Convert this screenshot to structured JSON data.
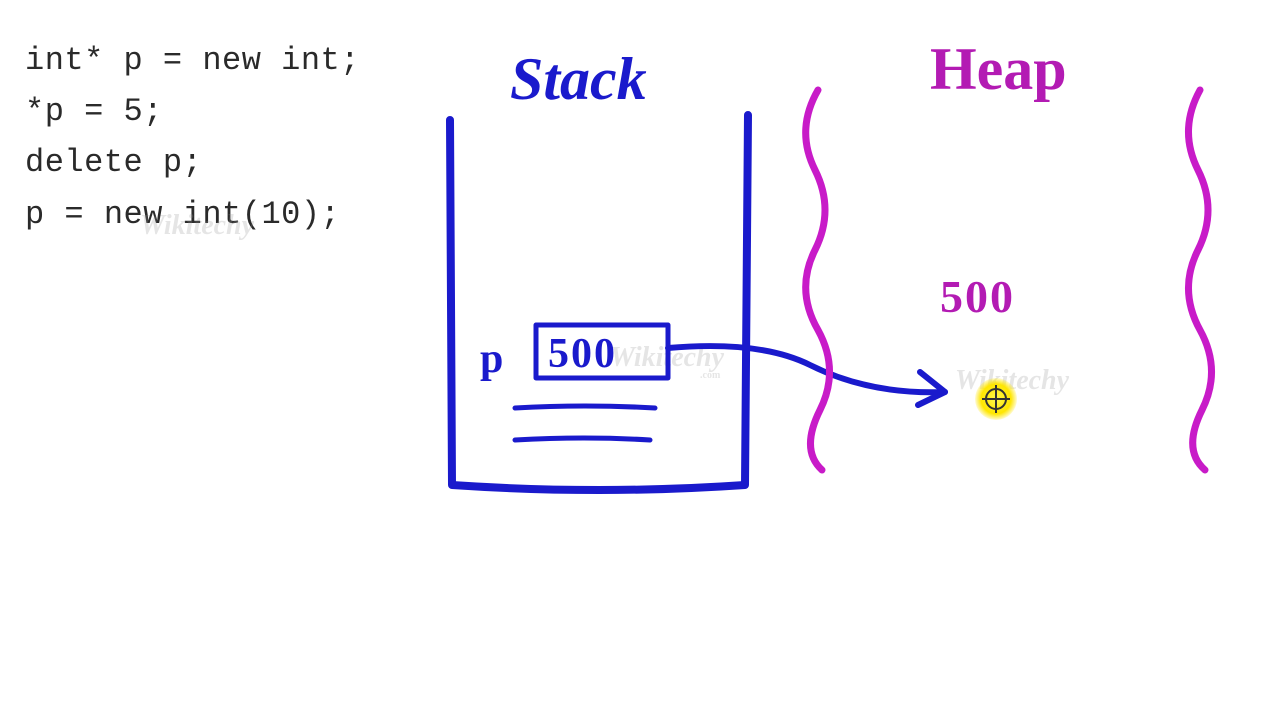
{
  "code": {
    "line1": "int* p = new int;",
    "line2": "*p = 5;",
    "line3": "delete p;",
    "line4": "p = new int(10);"
  },
  "labels": {
    "stack": "Stack",
    "heap": "Heap",
    "pointer_var": "p",
    "stack_address_value": "500",
    "heap_address": "500"
  },
  "watermark": {
    "main": "Wikitechy",
    "sub": ".com"
  },
  "colors": {
    "stack_ink": "#1a1acc",
    "heap_ink": "#b31bb3",
    "code_text": "#2a2a2a",
    "highlight": "#ffe600"
  }
}
